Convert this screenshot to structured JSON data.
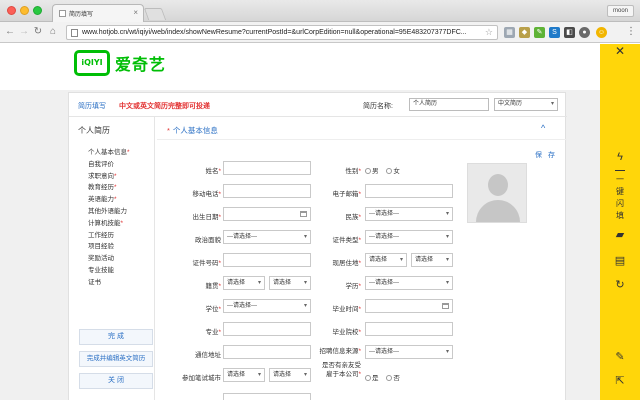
{
  "browser": {
    "tab_title": "简历填写",
    "tab_close": "×",
    "profile": "moon",
    "url": "www.hotjob.cn/wt/iqiyi/web/index/showNewResume?currentPostId=&urlCorpEdition=null&operational=95E483207377DFC..."
  },
  "brand": {
    "logo_mark": "iQIYI",
    "logo_text": "爱奇艺",
    "color": "#00be06"
  },
  "header": {
    "title": "简历填写",
    "tip": "中文或英文简历完整即可投递",
    "resume_name_label": "简历名称:",
    "resume_name_value": "个人简历",
    "language_select": "中文简历"
  },
  "leftnav": {
    "title": "个人简历",
    "items": [
      {
        "label": "个人基本信息",
        "required": "*"
      },
      {
        "label": "自我评价",
        "required": ""
      },
      {
        "label": "求职意向",
        "required": "*"
      },
      {
        "label": "教育经历",
        "required": "*"
      },
      {
        "label": "英语能力",
        "required": "*"
      },
      {
        "label": "其他外语能力",
        "required": ""
      },
      {
        "label": "计算机技能",
        "required": "*"
      },
      {
        "label": "工作经历",
        "required": ""
      },
      {
        "label": "项目经验",
        "required": ""
      },
      {
        "label": "奖励活动",
        "required": ""
      },
      {
        "label": "专业技能",
        "required": ""
      },
      {
        "label": "证书",
        "required": ""
      }
    ],
    "complete_button": "完 成",
    "complete_edit_en_button": "完成并编辑英文简历",
    "close_button": "关 闭"
  },
  "section": {
    "title": "个人基本信息",
    "required": "*",
    "collapse_icon": "^",
    "save": "保 存"
  },
  "form": {
    "name_label": "姓名",
    "gender_label": "性别",
    "gender_options": [
      "男",
      "女"
    ],
    "mobile_label": "移动电话",
    "email_label": "电子邮箱",
    "birthdate_label": "出生日期",
    "ethnicity_label": "民族",
    "ethnicity_value": "---请选择---",
    "political_label": "政治面貌",
    "political_value": "---请选择---",
    "idtype_label": "证件类型",
    "idtype_value": "---请选择---",
    "idnumber_label": "证件号码",
    "residence_label": "现居住地",
    "residence_value1": "请选择",
    "residence_value2": "请选择",
    "hometown_label": "籍贯",
    "hometown_value1": "请选择",
    "hometown_value2": "请选择",
    "education_label": "学历",
    "education_value": "---请选择---",
    "degree_label": "学位",
    "degree_value": "---请选择---",
    "gradtime_label": "毕业时间",
    "major_label": "专业",
    "school_label": "毕业院校",
    "address_label": "通信地址",
    "source_label": "招聘信息来源",
    "source_value": "---请选择---",
    "testcity_label": "参加笔试城市",
    "testcity_value1": "请选择",
    "testcity_value2": "请选择",
    "relative_label_1": "是否有亲友受",
    "relative_label_2": "雇于本公司",
    "relative_options": [
      "是",
      "否"
    ],
    "required_mark": "*"
  },
  "extension": {
    "vertical_text": "一键闪填",
    "color": "#ffd60a"
  }
}
